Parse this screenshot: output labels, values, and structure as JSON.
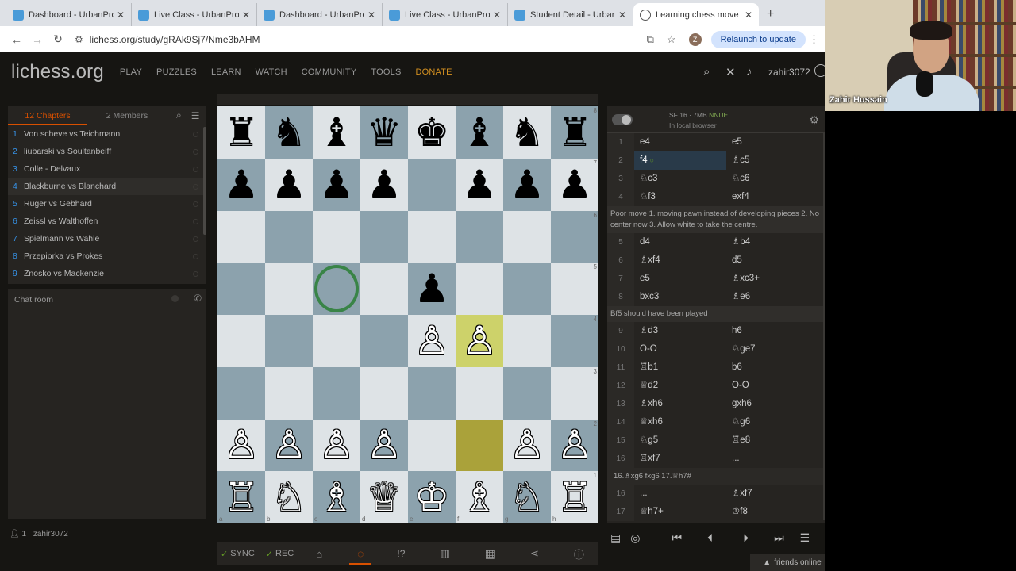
{
  "browser": {
    "tabs": [
      {
        "label": "Dashboard - UrbanPro.com"
      },
      {
        "label": "Live Class - UrbanPro.com"
      },
      {
        "label": "Dashboard - UrbanPro.com"
      },
      {
        "label": "Live Class - UrbanPro.com"
      },
      {
        "label": "Student Detail - UrbanPro"
      },
      {
        "label": "Learning chess move by m"
      }
    ],
    "url": "lichess.org/study/gRAk9Sj7/Nme3bAHM",
    "profile_initial": "Z",
    "relaunch_label": "Relaunch to update"
  },
  "site": {
    "logo": "lichess.org",
    "nav": [
      "PLAY",
      "PUZZLES",
      "LEARN",
      "WATCH",
      "COMMUNITY",
      "TOOLS",
      "DONATE"
    ],
    "username": "zahir3072"
  },
  "study": {
    "chapters_tab": "12 Chapters",
    "members_tab": "2 Members",
    "chapters": [
      {
        "n": "1",
        "name": "Von scheve vs Teichmann"
      },
      {
        "n": "2",
        "name": "liubarski vs Soultanbeiff"
      },
      {
        "n": "3",
        "name": "Colle - Delvaux"
      },
      {
        "n": "4",
        "name": "Blackburne vs Blanchard"
      },
      {
        "n": "5",
        "name": "Ruger vs Gebhard"
      },
      {
        "n": "6",
        "name": "Zeissl vs Walthoffen"
      },
      {
        "n": "7",
        "name": "Spielmann vs Wahle"
      },
      {
        "n": "8",
        "name": "Przepiorka vs Prokes"
      },
      {
        "n": "9",
        "name": "Znosko vs Mackenzie"
      }
    ],
    "chat_title": "Chat room",
    "member_count": "1",
    "member_name": "zahir3072"
  },
  "board": {
    "ranks": [
      "8",
      "7",
      "6",
      "5",
      "4",
      "3",
      "2",
      "1"
    ],
    "files": [
      "a",
      "b",
      "c",
      "d",
      "e",
      "f",
      "g",
      "h"
    ],
    "position": [
      [
        "♜",
        "♞",
        "♝",
        "♛",
        "♚",
        "♝",
        "♞",
        "♜"
      ],
      [
        "♟",
        "♟",
        "♟",
        "♟",
        "",
        "♟",
        "♟",
        "♟"
      ],
      [
        "",
        "",
        "",
        "",
        "",
        "",
        "",
        ""
      ],
      [
        "",
        "",
        "",
        "",
        "♟",
        "",
        "",
        ""
      ],
      [
        "",
        "",
        "",
        "",
        "♙",
        "♙",
        "",
        ""
      ],
      [
        "",
        "",
        "",
        "",
        "",
        "",
        "",
        ""
      ],
      [
        "♙",
        "♙",
        "♙",
        "♙",
        "",
        "",
        "♙",
        "♙"
      ],
      [
        "♖",
        "♘",
        "♗",
        "♕",
        "♔",
        "♗",
        "♘",
        "♖"
      ]
    ]
  },
  "controls": {
    "sync": "SYNC",
    "rec": "REC"
  },
  "engine": {
    "name": "SF 16 · 7MB",
    "nnue": "NNUE",
    "sub": "In local browser"
  },
  "moves_a": [
    {
      "n": "1",
      "w": "e4",
      "b": "e5"
    },
    {
      "n": "2",
      "w": "f4",
      "b": "♗c5"
    },
    {
      "n": "3",
      "w": "♘c3",
      "b": "♘c6"
    },
    {
      "n": "4",
      "w": "♘f3",
      "b": "exf4"
    }
  ],
  "comment1": "Poor move 1. moving pawn instead of developing pieces 2. No center now 3. Allow white to take the centre.",
  "moves_b": [
    {
      "n": "5",
      "w": "d4",
      "b": "♗b4"
    },
    {
      "n": "6",
      "w": "♗xf4",
      "b": "d5"
    },
    {
      "n": "7",
      "w": "e5",
      "b": "♗xc3+"
    },
    {
      "n": "8",
      "w": "bxc3",
      "b": "♗e6"
    }
  ],
  "comment2": "Bf5 should have been played",
  "moves_c": [
    {
      "n": "9",
      "w": "♗d3",
      "b": "h6"
    },
    {
      "n": "10",
      "w": "O-O",
      "b": "♘ge7"
    },
    {
      "n": "11",
      "w": "♖b1",
      "b": "b6"
    },
    {
      "n": "12",
      "w": "♕d2",
      "b": "O-O"
    },
    {
      "n": "13",
      "w": "♗xh6",
      "b": "gxh6"
    },
    {
      "n": "14",
      "w": "♕xh6",
      "b": "♘g6"
    },
    {
      "n": "15",
      "w": "♘g5",
      "b": "♖e8"
    },
    {
      "n": "16",
      "w": "♖xf7",
      "b": "..."
    }
  ],
  "variation": "16.♗xg6 fxg6 17.♕h7#",
  "moves_d": [
    {
      "n": "16",
      "w": "...",
      "b": "♗xf7"
    },
    {
      "n": "17",
      "w": "♕h7+",
      "b": "♔f8"
    }
  ],
  "friends_label": "friends online",
  "webcam_name": "Zahir Hussain"
}
